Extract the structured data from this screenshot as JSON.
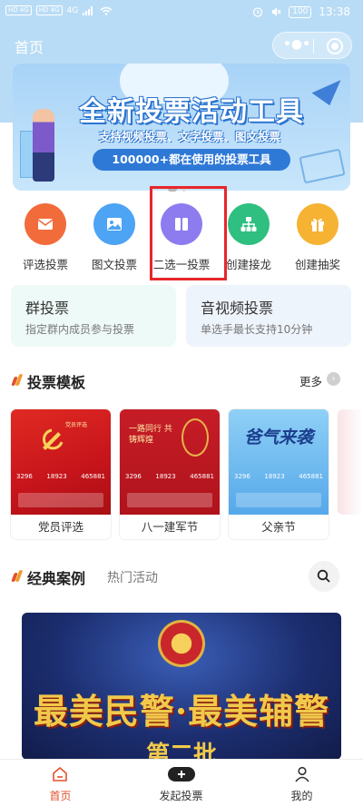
{
  "status_bar": {
    "sim1": "HD 4G",
    "sim2": "HD 4G",
    "signal": "4G",
    "time": "13:38",
    "battery": "100"
  },
  "header": {
    "title": "首页"
  },
  "banner": {
    "title": "全新投票活动工具",
    "subtitle": "支持视频投票、文字投票、图文投票",
    "tagline": "100000+都在使用的投票工具"
  },
  "actions": [
    {
      "label": "评选投票",
      "icon": "envelope-icon",
      "color": "#f26b3a"
    },
    {
      "label": "图文投票",
      "icon": "image-icon",
      "color": "#4da3f4"
    },
    {
      "label": "二选一投票",
      "icon": "two-panels-icon",
      "color": "#8d7cf0"
    },
    {
      "label": "创建接龙",
      "icon": "hierarchy-icon",
      "color": "#2fbf80"
    },
    {
      "label": "创建抽奖",
      "icon": "gift-icon",
      "color": "#f6b232"
    }
  ],
  "vote_cards": [
    {
      "title": "群投票",
      "subtitle": "指定群内成员参与投票"
    },
    {
      "title": "音视频投票",
      "subtitle": "单选手最长支持10分钟"
    }
  ],
  "templates_section": {
    "title": "投票模板",
    "more": "更多",
    "items": [
      {
        "name": "党员评选",
        "heading": "党员评选",
        "stats": [
          "3296",
          "18923",
          "465881"
        ]
      },
      {
        "name": "八一建军节",
        "heading": "一路同行 共铸辉煌",
        "stats": [
          "3296",
          "18923",
          "465881"
        ]
      },
      {
        "name": "父亲节",
        "heading": "爸气来袭",
        "stats": [
          "3296",
          "18923",
          "465881"
        ]
      }
    ]
  },
  "cases_section": {
    "title": "经典案例",
    "tab": "热门活动",
    "case_title": "最美民警·最美辅警",
    "case_sub": "第二批"
  },
  "tabbar": [
    {
      "label": "首页",
      "icon": "home-icon",
      "active": true
    },
    {
      "label": "发起投票",
      "icon": "plus-icon",
      "active": false
    },
    {
      "label": "我的",
      "icon": "user-icon",
      "active": false
    }
  ],
  "colors": {
    "header_bg": "#b9dcf6",
    "highlight": "#e8262b",
    "accent": "#e3512b"
  }
}
